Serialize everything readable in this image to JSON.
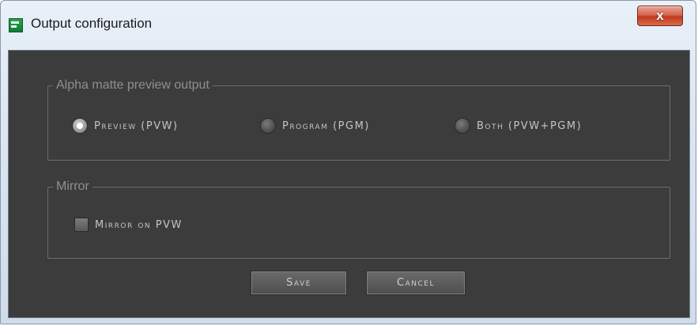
{
  "window": {
    "title": "Output configuration",
    "close_label": "x"
  },
  "alpha_group": {
    "legend": "Alpha matte preview output",
    "options": [
      {
        "label": "Preview (PVW)",
        "checked": true
      },
      {
        "label": "Program (PGM)",
        "checked": false
      },
      {
        "label": "Both (PVW+PGM)",
        "checked": false
      }
    ]
  },
  "mirror_group": {
    "legend": "Mirror",
    "checkbox_label": "Mirror on PVW",
    "checked": false
  },
  "buttons": {
    "save_label": "Save",
    "cancel_label": "Cancel"
  },
  "colors": {
    "dialog_background": "#3c3c3c",
    "close_button": "#c1391e"
  }
}
